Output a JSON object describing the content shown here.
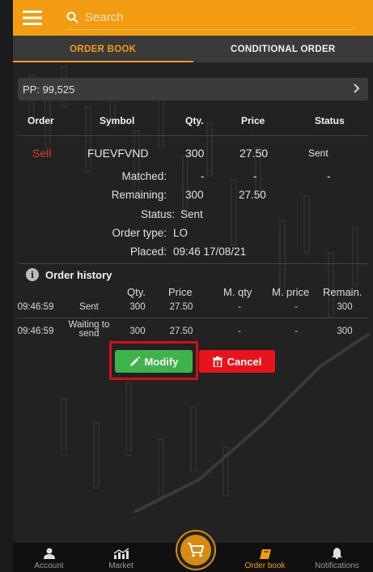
{
  "search": {
    "placeholder": "Search"
  },
  "tabs": [
    {
      "label": "ORDER BOOK",
      "active": true
    },
    {
      "label": "CONDITIONAL ORDER",
      "active": false
    }
  ],
  "pp": {
    "label": "PP: 99,525"
  },
  "table": {
    "headers": [
      "Order",
      "Symbol",
      "Qty.",
      "Price",
      "Status"
    ],
    "order": {
      "side": "Sell",
      "symbol": "FUEVFVND",
      "qty": "300",
      "price": "27.50",
      "status": "Sent"
    }
  },
  "details": {
    "matched": {
      "label": "Matched:",
      "qty": "-",
      "price": "-",
      "status": "-"
    },
    "remaining": {
      "label": "Remaining:",
      "qty": "300",
      "price": "27.50"
    },
    "status": {
      "label": "Status:",
      "value": "Sent"
    },
    "order_type": {
      "label": "Order type:",
      "value": "LO"
    },
    "placed": {
      "label": "Placed:",
      "value": "09:46 17/08/21"
    }
  },
  "history": {
    "title": "Order history",
    "info_glyph": "i",
    "headers": [
      "Qty.",
      "Price",
      "M. qty",
      "M. price",
      "Remain."
    ],
    "rows": [
      {
        "time": "09:46:59",
        "status": "Sent",
        "qty": "300",
        "price": "27.50",
        "m_qty": "-",
        "m_price": "-",
        "remain": "300"
      },
      {
        "time": "09:46:59",
        "status_line1": "Waiting to",
        "status_line2": "send",
        "qty": "300",
        "price": "27.50",
        "m_qty": "-",
        "m_price": "-",
        "remain": "300"
      }
    ]
  },
  "actions": {
    "modify_label": "Modify",
    "cancel_label": "Cancel"
  },
  "nav": [
    {
      "label": "Account",
      "icon": "person-icon"
    },
    {
      "label": "Market",
      "icon": "chart-icon"
    },
    {
      "label": "",
      "icon": "cart-icon"
    },
    {
      "label": "Order book",
      "icon": "book-icon",
      "active": true
    },
    {
      "label": "Notifications",
      "icon": "bell-icon"
    }
  ],
  "colors": {
    "accent": "#f39c12",
    "sell": "#e53935",
    "modify": "#3db34a",
    "cancel": "#e8141b",
    "highlight": "#d0101a"
  }
}
